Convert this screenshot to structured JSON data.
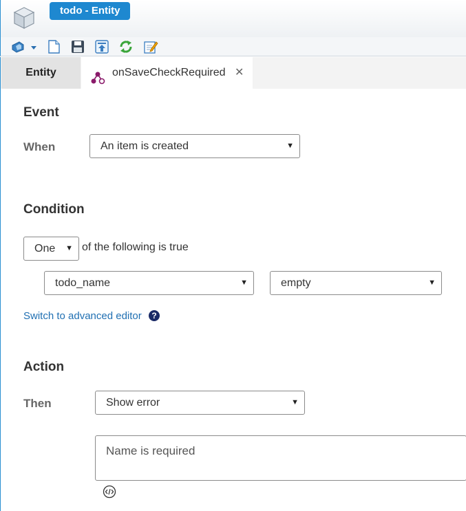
{
  "window": {
    "title": "todo - Entity",
    "logo_icon": "entity-cube-icon"
  },
  "toolbar": {
    "icons": [
      "shield-dropdown-icon",
      "new-document-icon",
      "save-icon",
      "publish-icon",
      "refresh-icon",
      "edit-icon"
    ]
  },
  "tabs": [
    {
      "label": "Entity",
      "active": false
    },
    {
      "label": "onSaveCheckRequired",
      "active": true,
      "icon": "business-rule-icon",
      "close": "✕"
    }
  ],
  "event": {
    "title": "Event",
    "when_label": "When",
    "when_value": "An item is created"
  },
  "condition": {
    "title": "Condition",
    "quantifier_value": "One",
    "quantifier_suffix": "of the following is true",
    "field_value": "todo_name",
    "operator_value": "empty",
    "advanced_link": "Switch to advanced editor",
    "help_glyph": "?"
  },
  "action": {
    "title": "Action",
    "then_label": "Then",
    "then_value": "Show error",
    "message_value": "Name is required"
  },
  "colors": {
    "accent": "#1e88d0",
    "link": "#1f6fb2",
    "window_border": "#2a8fd1"
  }
}
